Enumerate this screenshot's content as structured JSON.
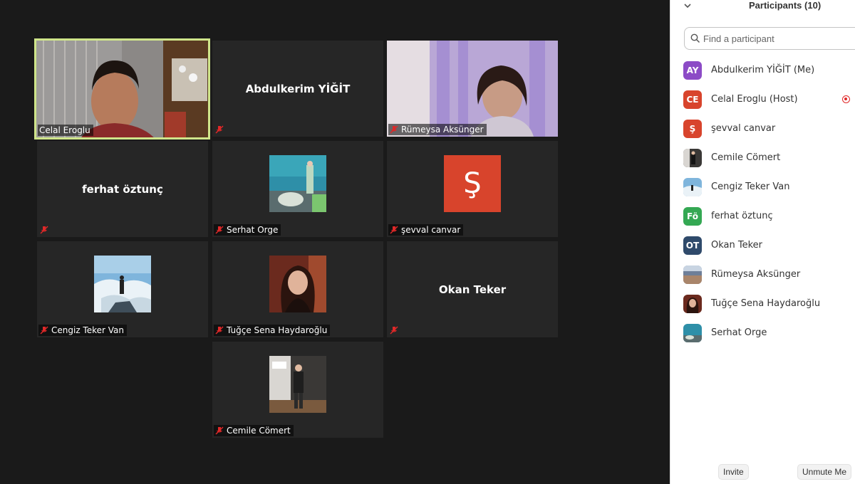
{
  "gallery": {
    "tiles": [
      {
        "id": "celal",
        "label": "Celal Eroglu"
      },
      {
        "id": "abdulkerim",
        "center": "Abdulkerim YİĞİT"
      },
      {
        "id": "rumeysa",
        "label": "Rümeysa Aksünger"
      },
      {
        "id": "ferhat",
        "center": "ferhat öztunç"
      },
      {
        "id": "serhat",
        "label": "Serhat Orge"
      },
      {
        "id": "sevval",
        "label": "şevval canvar",
        "avatar_letter": "Ş"
      },
      {
        "id": "cengiz",
        "label": "Cengiz Teker Van"
      },
      {
        "id": "tugce",
        "label": "Tuğçe Sena Haydaroğlu"
      },
      {
        "id": "okan",
        "center": "Okan Teker"
      },
      {
        "id": "cemile",
        "label": "Cemile Cömert"
      }
    ]
  },
  "panel": {
    "title": "Participants (10)",
    "search_placeholder": "Find a participant",
    "participants": [
      {
        "initials": "AY",
        "name": "Abdulkerim YİĞİT (Me)",
        "color": "#8c4bc6"
      },
      {
        "initials": "CE",
        "name": "Celal Eroglu (Host)",
        "color": "#d8442c"
      },
      {
        "initials": "Ş",
        "name": "şevval canvar",
        "color": "#d8442c"
      },
      {
        "name": "Cemile Cömert"
      },
      {
        "name": "Cengiz Teker Van"
      },
      {
        "initials": "Fö",
        "name": "ferhat öztunç",
        "color": "#34a853"
      },
      {
        "initials": "OT",
        "name": "Okan Teker",
        "color": "#2f4a6b"
      },
      {
        "name": "Rümeysa Aksünger"
      },
      {
        "name": "Tuğçe Sena Haydaroğlu"
      },
      {
        "name": "Serhat Orge"
      }
    ],
    "invite_label": "Invite",
    "unmute_label": "Unmute Me"
  },
  "colors": {
    "active_border": "#cfe58a",
    "tile_bg": "#262626",
    "mute_red": "#e02828"
  }
}
